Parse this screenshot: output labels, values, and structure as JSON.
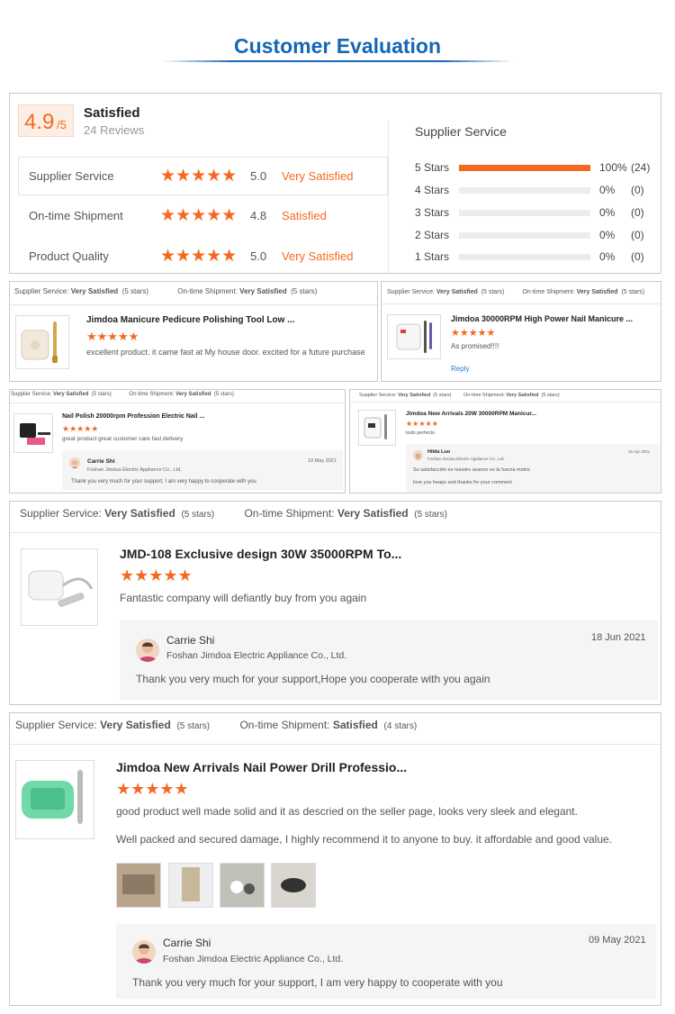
{
  "page_title": "Customer Evaluation",
  "summary": {
    "score": "4.9",
    "score_denominator": "/5",
    "label": "Satisfied",
    "reviews_count": "24 Reviews",
    "metrics": [
      {
        "name": "Supplier Service",
        "value": "5.0",
        "verdict": "Very Satisfied"
      },
      {
        "name": "On-time Shipment",
        "value": "4.8",
        "verdict": "Satisfied"
      },
      {
        "name": "Product Quality",
        "value": "5.0",
        "verdict": "Very Satisfied"
      }
    ],
    "distribution_title": "Supplier Service",
    "distribution": [
      {
        "label": "5 Stars",
        "percent": "100%",
        "count": "(24)",
        "fraction": 1.0
      },
      {
        "label": "4 Stars",
        "percent": "0%",
        "count": "(0)",
        "fraction": 0
      },
      {
        "label": "3 Stars",
        "percent": "0%",
        "count": "(0)",
        "fraction": 0
      },
      {
        "label": "2 Stars",
        "percent": "0%",
        "count": "(0)",
        "fraction": 0
      },
      {
        "label": "1 Stars",
        "percent": "0%",
        "count": "(0)",
        "fraction": 0
      }
    ]
  },
  "stars": "★★★★★",
  "labels": {
    "supplier_service": "Supplier Service:",
    "ontime_shipment": "On-time Shipment:",
    "very_satisfied": "Very Satisfied",
    "satisfied": "Satisfied",
    "five_stars": "(5 stars)",
    "four_stars": "(4 stars)"
  },
  "reviews": [
    {
      "product": "Jimdoa Manicure Pedicure Polishing Tool Low ...",
      "text": "excellent product. it came fast at My house door. excited for a future purchase"
    },
    {
      "product": "Jimdoa 30000RPM High Power Nail Manicure ...",
      "text": "As promised!!!!",
      "reply_link": "Reply"
    },
    {
      "product": "Nail Polish 20000rpm Profession Electric Nail ...",
      "text": "great product great customer care fast delivery",
      "reply": {
        "name": "Carrie Shi",
        "company": "Foshan Jimdoa Electric Appliance Co., Ltd.",
        "date": "19 May 2021",
        "text": "Thank you very much for your support, I am very happy to cooperate with you"
      }
    },
    {
      "product": "Jimdoa New Arrivals 20W 30000RPM Manicur...",
      "text": "todo perfecto",
      "reply": {
        "name": "Hilda Luo",
        "company": "Foshan Jimdoa Electric Appliance Co., Ltd.",
        "date": "15 Apr 2021",
        "text": "Su satisfacción es nuestro avance es la fuerza motriz",
        "text2": "love you heaps and thanks for your comment"
      }
    },
    {
      "product": "JMD-108 Exclusive design 30W 35000RPM To...",
      "text": "Fantastic company will defiantly buy from you again",
      "reply": {
        "name": "Carrie Shi",
        "company": "Foshan Jimdoa Electric Appliance Co., Ltd.",
        "date": "18 Jun 2021",
        "text": "Thank you very much for your support,Hope you cooperate with you again"
      }
    },
    {
      "product": "Jimdoa New Arrivals Nail Power Drill Professio...",
      "text": "good product well made solid and it as descried on the seller page, looks very sleek and elegant.",
      "text2": "Well packed and secured damage, I highly recommend it to anyone to buy. it affordable and good value.",
      "reply": {
        "name": "Carrie Shi",
        "company": "Foshan Jimdoa Electric Appliance Co., Ltd.",
        "date": "09 May 2021",
        "text": "Thank you very much for your support, I am very happy to cooperate with you"
      }
    }
  ],
  "colors": {
    "accent": "#f4691e",
    "title_blue": "#1567b8",
    "link_blue": "#2a7bd4"
  }
}
